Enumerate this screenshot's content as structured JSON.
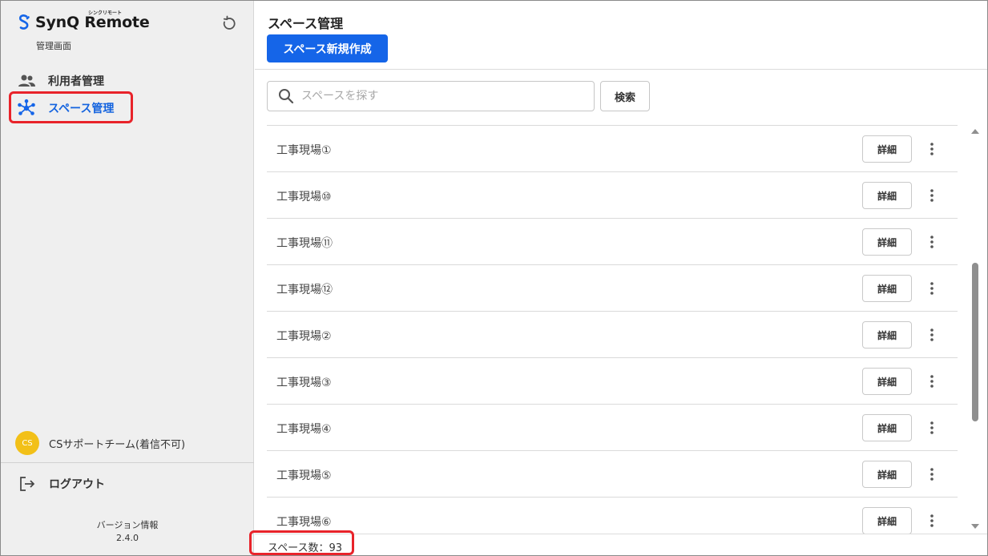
{
  "sidebar": {
    "logo_text": "SynQ Remote",
    "logo_ruby": "シンクリモート",
    "admin_label": "管理画面",
    "nav": [
      {
        "label": "利用者管理",
        "icon": "users-icon"
      },
      {
        "label": "スペース管理",
        "icon": "network-icon",
        "active": true
      }
    ],
    "user": {
      "initials": "CS",
      "name": "CSサポートチーム(着信不可)"
    },
    "logout_label": "ログアウト",
    "version_label": "バージョン情報",
    "version": "2.4.0"
  },
  "header": {
    "title": "スペース管理",
    "create_button": "スペース新規作成"
  },
  "search": {
    "placeholder": "スペースを探す",
    "button": "検索"
  },
  "spaces": {
    "detail_label": "詳細",
    "items": [
      "工事現場①",
      "工事現場⑩",
      "工事現場⑪",
      "工事現場⑫",
      "工事現場②",
      "工事現場③",
      "工事現場④",
      "工事現場⑤",
      "工事現場⑥"
    ]
  },
  "footer": {
    "count_text": "スペース数：93"
  },
  "colors": {
    "accent": "#1565e8",
    "highlight": "#e8232a",
    "avatar": "#f2c018"
  }
}
